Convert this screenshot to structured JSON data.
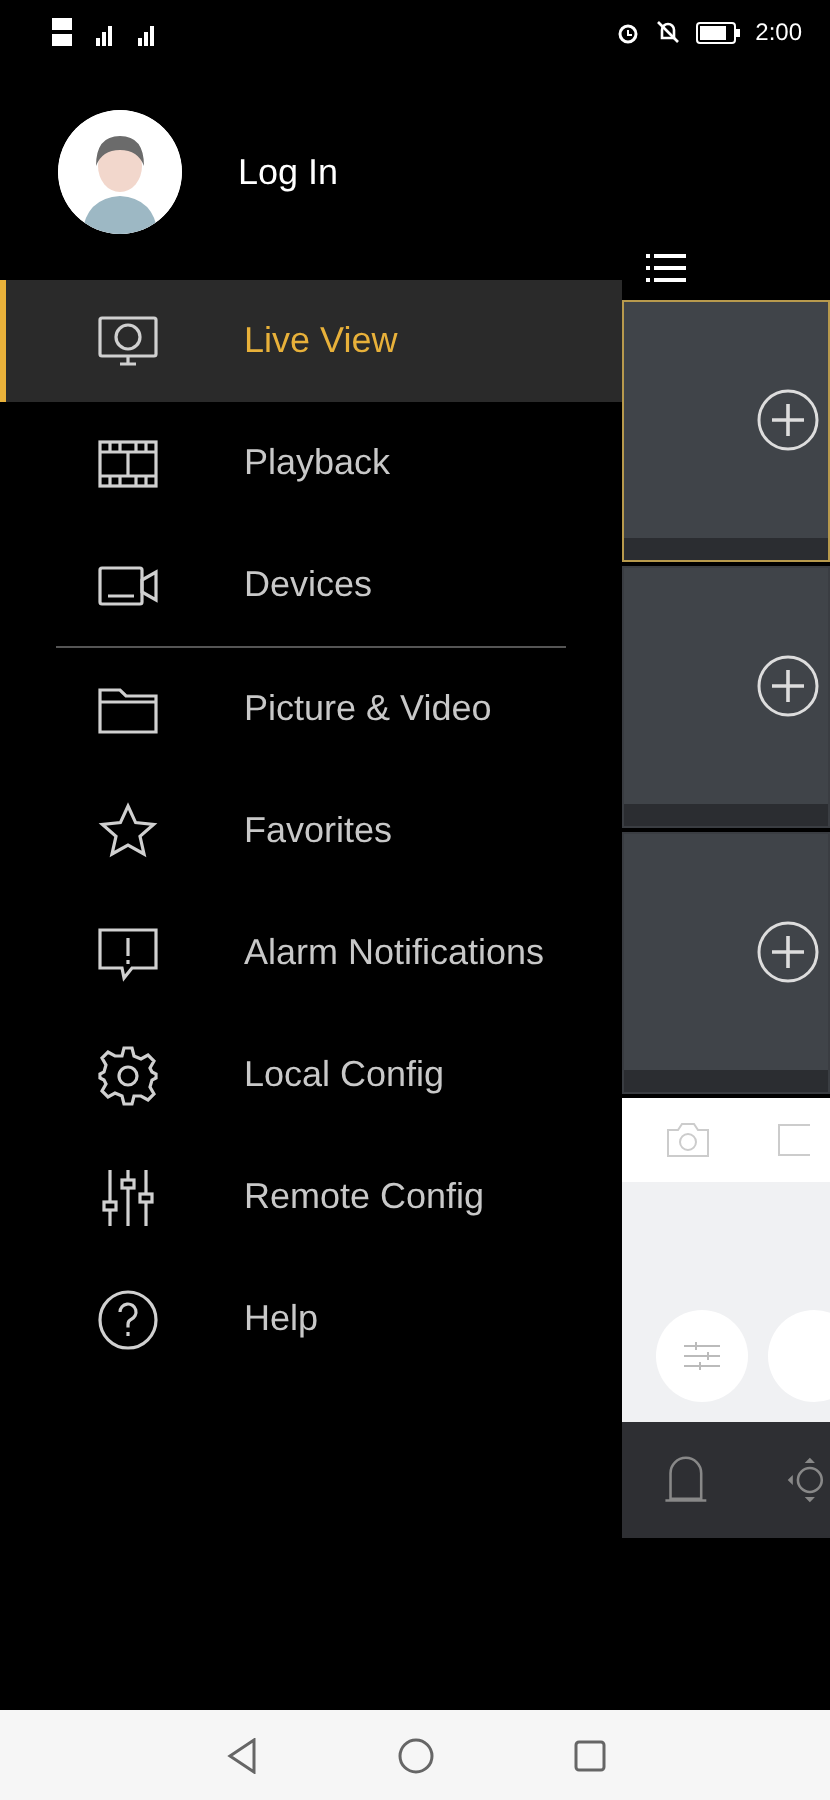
{
  "status_bar": {
    "time": "2:00"
  },
  "profile": {
    "label": "Log In"
  },
  "menu_sections": [
    {
      "items": [
        {
          "label": "Live View",
          "selected": true
        },
        {
          "label": "Playback",
          "selected": false
        },
        {
          "label": "Devices",
          "selected": false
        }
      ]
    },
    {
      "items": [
        {
          "label": "Picture & Video",
          "selected": false
        },
        {
          "label": "Favorites",
          "selected": false
        },
        {
          "label": "Alarm Notifications",
          "selected": false
        },
        {
          "label": "Local Config",
          "selected": false
        },
        {
          "label": "Remote Config",
          "selected": false
        },
        {
          "label": "Help",
          "selected": false
        }
      ]
    }
  ],
  "video_tiles": [
    {
      "selected": true
    },
    {
      "selected": false
    },
    {
      "selected": false
    }
  ]
}
